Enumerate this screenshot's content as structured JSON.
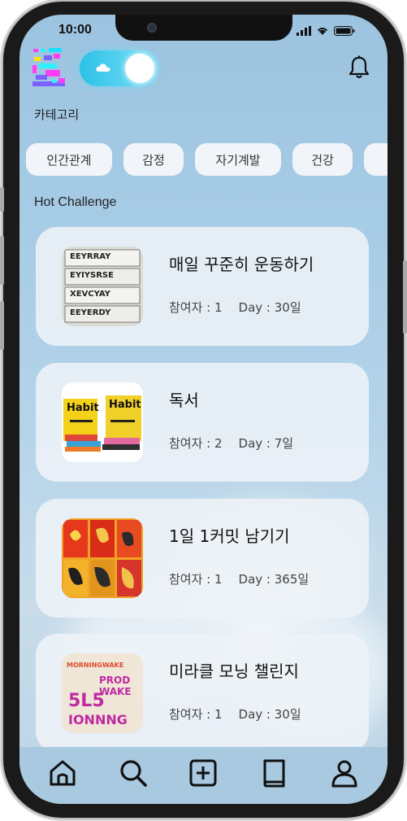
{
  "status_bar": {
    "time": "10:00"
  },
  "header": {
    "logo_icon": "app-logo-icon",
    "toggle_on": true,
    "bell_icon": "bell-icon"
  },
  "categories": {
    "title": "카테고리",
    "items": [
      "인간관계",
      "감정",
      "자기계발",
      "건강",
      ""
    ]
  },
  "hot": {
    "title": "Hot Challenge",
    "cards": [
      {
        "title": "매일 꾸준히 운동하기",
        "participants": "참여자 : 1",
        "days": "Day : 30일",
        "thumb_lines": [
          "EEYRRAY",
          "EYIYSRSE",
          "XEVCYAY",
          "EEYERDY"
        ]
      },
      {
        "title": "독서",
        "participants": "참여자 : 2",
        "days": "Day : 7일",
        "thumb_lines": [
          "Habit",
          "Habit"
        ]
      },
      {
        "title": "1일 1커밋 남기기",
        "participants": "참여자 : 1",
        "days": "Day : 365일"
      },
      {
        "title": "미라클 모닝 챌린지",
        "participants": "참여자 : 1",
        "days": "Day : 30일",
        "thumb_lines": [
          "MORNINGWAKE",
          "PROD",
          "WAKE",
          "5L5",
          "IONNNG"
        ]
      }
    ]
  },
  "nav": {
    "items": [
      {
        "icon": "home-icon"
      },
      {
        "icon": "search-icon"
      },
      {
        "icon": "add-icon"
      },
      {
        "icon": "book-icon"
      },
      {
        "icon": "profile-icon"
      }
    ]
  },
  "colors": {
    "accent_toggle": "#2bc1e8",
    "card_bg": "#eef3f7",
    "nav_bg": "#a9c9e0"
  }
}
